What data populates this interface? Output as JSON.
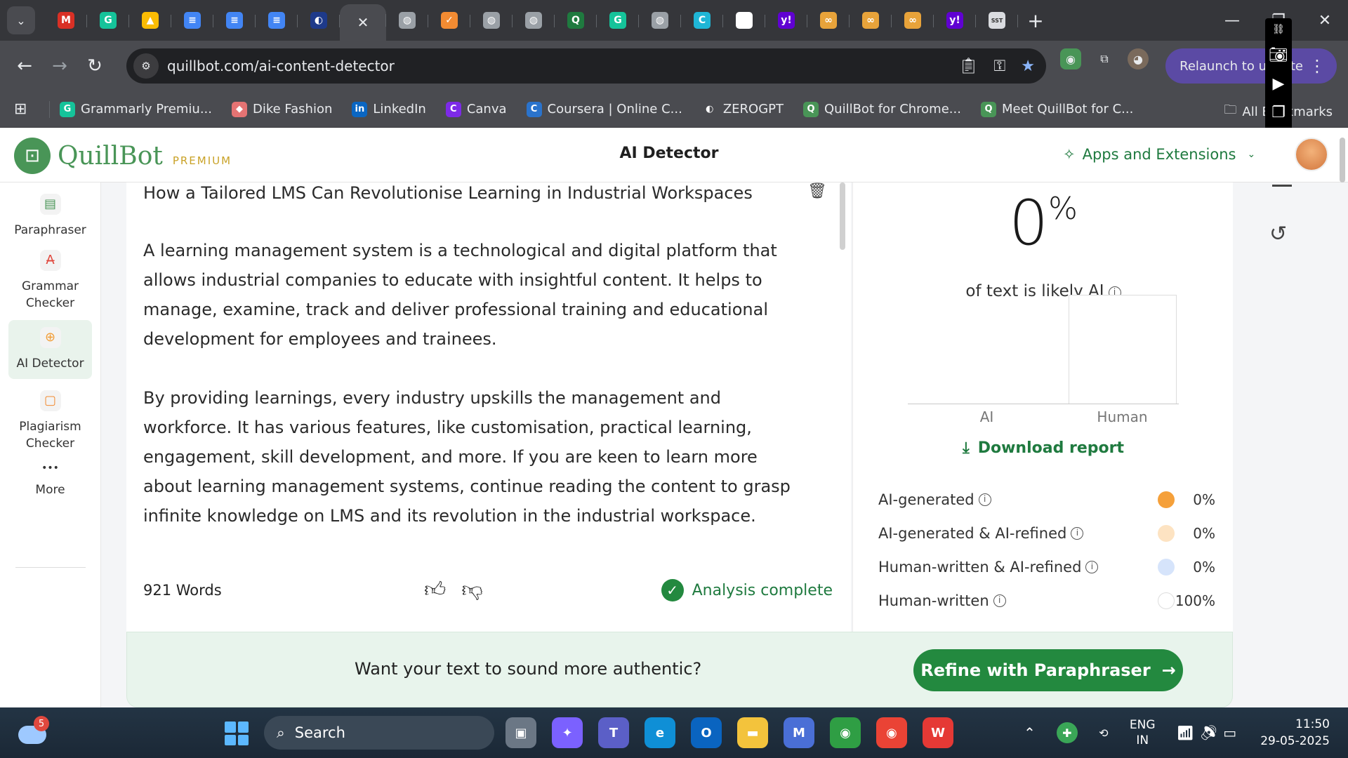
{
  "browser": {
    "tab_menu_icon": "chevron-down-icon",
    "tabs": [
      {
        "icon": "M",
        "color": "#d93025"
      },
      {
        "icon": "G",
        "color": "#15c39a"
      },
      {
        "icon": "▲",
        "color": "#fbbc04"
      },
      {
        "icon": "≡",
        "color": "#4285f4"
      },
      {
        "icon": "≡",
        "color": "#4285f4"
      },
      {
        "icon": "≡",
        "color": "#4285f4"
      },
      {
        "icon": "◐",
        "color": "#1e3a8a"
      },
      {
        "icon": "✕",
        "color": "#e8eaed",
        "active": true
      },
      {
        "icon": "◍",
        "color": "#9aa0a6"
      },
      {
        "icon": "✓",
        "color": "#f28b32"
      },
      {
        "icon": "◍",
        "color": "#9aa0a6"
      },
      {
        "icon": "◍",
        "color": "#9aa0a6"
      },
      {
        "icon": "Q",
        "color": "#1f7a3f"
      },
      {
        "icon": "G",
        "color": "#15c39a"
      },
      {
        "icon": "◍",
        "color": "#9aa0a6"
      },
      {
        "icon": "C",
        "color": "#1fb6d6"
      },
      {
        "icon": "✺",
        "color": "#ffffff"
      },
      {
        "icon": "y!",
        "color": "#6001d2"
      },
      {
        "icon": "∞",
        "color": "#e8a33a"
      },
      {
        "icon": "∞",
        "color": "#e8a33a"
      },
      {
        "icon": "∞",
        "color": "#e8a33a"
      },
      {
        "icon": "y!",
        "color": "#6001d2"
      },
      {
        "icon": "SST",
        "color": "#dadce0"
      }
    ],
    "new_tab_icon": "+",
    "url": "quillbot.com/ai-content-detector",
    "relaunch_label": "Relaunch to update",
    "bookmarks": [
      {
        "label": "Grammarly Premiu...",
        "icon": "G",
        "color": "#15c39a"
      },
      {
        "label": "Dike Fashion",
        "icon": "◆",
        "color": "#e57373"
      },
      {
        "label": "LinkedIn",
        "icon": "in",
        "color": "#0a66c2"
      },
      {
        "label": "Canva",
        "icon": "C",
        "color": "#7d2ae8"
      },
      {
        "label": "Coursera | Online C...",
        "icon": "C",
        "color": "#2a73cc"
      },
      {
        "label": "ZEROGPT",
        "icon": "◐",
        "color": "#4a4b50"
      },
      {
        "label": "QuillBot for Chrome...",
        "icon": "Q",
        "color": "#499557"
      },
      {
        "label": "Meet QuillBot for C...",
        "icon": "Q",
        "color": "#499557"
      }
    ],
    "all_bookmarks_label": "All Bookmarks"
  },
  "header": {
    "brand": "QuillBot",
    "tier": "PREMIUM",
    "page_title": "AI Detector",
    "apps_label": "Apps and Extensions"
  },
  "sidebar": {
    "items": [
      {
        "label": "Paraphraser",
        "icon": "paraphraser-icon",
        "glyph": "▤",
        "color": "#499557"
      },
      {
        "label": "Grammar Checker",
        "icon": "grammar-icon",
        "glyph": "A̶",
        "color": "#e0483e"
      },
      {
        "label": "AI Detector",
        "icon": "ai-detector-icon",
        "glyph": "⊕",
        "color": "#f29e38",
        "active": true
      },
      {
        "label": "Plagiarism Checker",
        "icon": "plagiarism-icon",
        "glyph": "▢",
        "color": "#f28b32"
      },
      {
        "label": "More",
        "icon": "more-icon",
        "glyph": "•••",
        "color": "#333333"
      }
    ]
  },
  "editor": {
    "title": "How a Tailored LMS Can Revolutionise Learning in Industrial Workspaces",
    "paragraphs": [
      "A learning management system is a technological and digital platform that allows industrial companies to educate with insightful content. It helps to manage, examine, track and deliver professional training and educational development for employees and trainees.",
      "By providing learnings, every industry upskills the management and workforce. It has various features, like customisation, practical learning, engagement, skill development, and more. If you are keen to learn more about learning management systems, continue reading the content to grasp infinite knowledge on LMS and its revolution in the industrial workspace."
    ],
    "word_count": "921 Words",
    "status": "Analysis complete"
  },
  "result": {
    "percent": "0",
    "percent_sign": "%",
    "subtitle": "of text is likely AI",
    "download_label": "Download report",
    "legend": [
      {
        "label": "AI-generated",
        "value": "0%",
        "color": "#f5a03a"
      },
      {
        "label": "AI-generated & AI-refined",
        "value": "0%",
        "color": "#fde3c2"
      },
      {
        "label": "Human-written & AI-refined",
        "value": "0%",
        "color": "#d6e4fb"
      },
      {
        "label": "Human-written",
        "value": "100%",
        "color": "#ffffff"
      }
    ]
  },
  "chart_data": {
    "type": "bar",
    "categories": [
      "AI",
      "Human"
    ],
    "values": [
      0,
      100
    ],
    "ylim": [
      0,
      100
    ],
    "grid": false
  },
  "cta": {
    "text": "Want your text to sound more authentic?",
    "button": "Refine with Paraphraser"
  },
  "taskbar": {
    "weather_badge": "5",
    "search_placeholder": "Search",
    "apps": [
      {
        "name": "task-view",
        "glyph": "▣",
        "color": "#6b7785"
      },
      {
        "name": "copilot",
        "glyph": "✦",
        "color": "#7b61ff"
      },
      {
        "name": "teams",
        "glyph": "T",
        "color": "#5b5fc7"
      },
      {
        "name": "edge",
        "glyph": "e",
        "color": "#0f8fd6"
      },
      {
        "name": "outlook",
        "glyph": "O",
        "color": "#0a64c0"
      },
      {
        "name": "file-explorer",
        "glyph": "▬",
        "color": "#f3c33c"
      },
      {
        "name": "m365",
        "glyph": "M",
        "color": "#4a6fd6"
      },
      {
        "name": "chrome-profile",
        "glyph": "◉",
        "color": "#2f9e44"
      },
      {
        "name": "chrome",
        "glyph": "◉",
        "color": "#ea4335"
      },
      {
        "name": "wps",
        "glyph": "W",
        "color": "#e53935"
      }
    ],
    "lang_top": "ENG",
    "lang_bottom": "IN",
    "time": "11:50",
    "date": "29-05-2025"
  }
}
